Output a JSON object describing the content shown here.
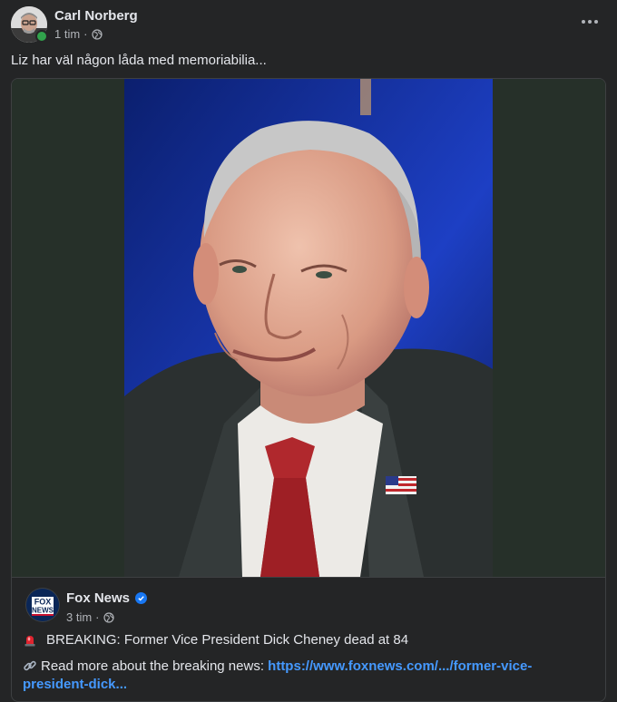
{
  "post": {
    "author": "Carl Norberg",
    "time": "1 tim",
    "separator": "·",
    "caption": "Liz har väl någon låda med memoriabilia..."
  },
  "shared": {
    "source": "Fox News",
    "time": "3 tim",
    "separator": "·",
    "headline": "BREAKING: Former Vice President Dick Cheney dead at 84",
    "readmore_text": "Read more about the breaking news: ",
    "link_text": "https://www.foxnews.com/.../former-vice-president-dick...",
    "logo_text_top": "FOX",
    "logo_text_bottom": "NEWS"
  },
  "icons": {
    "globe": "globe-icon",
    "more": "more-options-icon",
    "siren": "siren-icon",
    "link": "link-icon",
    "verified": "verified-badge-icon"
  },
  "colors": {
    "background": "#242526",
    "link": "#4599ff",
    "verified": "#1877f2",
    "online": "#31a24c"
  }
}
